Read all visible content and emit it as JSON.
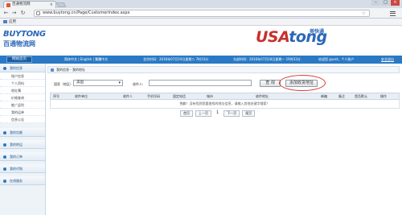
{
  "browser": {
    "tab_title": "百通物流网",
    "url": "www.buytong.cn/Page/CustomerIndex.aspx",
    "bookmark_label": "应用"
  },
  "header": {
    "brand_en": "BUYTONG",
    "brand_cn": "百通物流网",
    "right_logo_usa": "USA",
    "right_logo_tong": "tong",
    "right_logo_cn": "美快通"
  },
  "topbar": {
    "home_label": "网站首页",
    "lang_text": "简体中文 | English | 繁體中文",
    "balance_text": "北京时间：2016年07月19日星期二 7时33分",
    "balance2_text": "东部时间：2016年07月18日星期一 19时33分",
    "user_text": "欢迎您 guest，个人账户",
    "logout_label": "安全退出"
  },
  "sidebar": {
    "groups": [
      {
        "label": "我的信息",
        "items": [
          "账户信息",
          "个人资料",
          "地址簿",
          "价格查询",
          "推广返利",
          "我的运单",
          "信息公告"
        ]
      },
      {
        "label": "我的包裹",
        "items": []
      },
      {
        "label": "我的转运",
        "items": []
      },
      {
        "label": "我的订单",
        "items": []
      },
      {
        "label": "我的代购",
        "items": []
      },
      {
        "label": "在线服务",
        "items": []
      }
    ]
  },
  "main": {
    "breadcrumb": "我的信息 - 我的地址",
    "search": {
      "field_label": "国家（地区）:",
      "select_value": "美国",
      "name_label": "收件人:",
      "search_button": "查 询",
      "add_button": "添加收货地址"
    },
    "table": {
      "columns": [
        "序号",
        "收件单位",
        "收件人",
        "手机号码",
        "固定电话",
        "城市",
        "收件地址",
        "邮编",
        "备注",
        "是否默认",
        "操作"
      ],
      "empty_message": "抱歉！没有找到您要查找的地址信息，请输入其他关键字搜索！"
    },
    "pager": {
      "first": "首页",
      "prev": "上一页",
      "current": "1",
      "next": "下一页",
      "last": "尾页"
    }
  }
}
